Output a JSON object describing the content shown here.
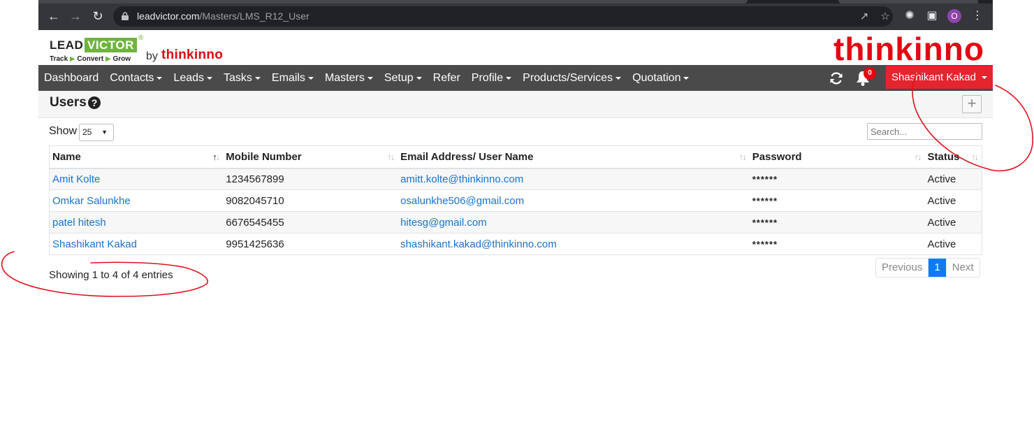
{
  "browser": {
    "url_host": "leadvictor.com",
    "url_path": "/Masters/LMS_R12_User",
    "profile_initial": "O"
  },
  "brand": {
    "logo_lead": "LEAD",
    "logo_victor": "VICTOR",
    "logo_reg": "®",
    "tagline": [
      "Track",
      "Convert",
      "Grow"
    ],
    "by": "by",
    "by_brand": "thinkinno",
    "right_brand": "thinkinno"
  },
  "nav": {
    "items": [
      {
        "label": "Dashboard",
        "dropdown": false
      },
      {
        "label": "Contacts",
        "dropdown": true
      },
      {
        "label": "Leads",
        "dropdown": true
      },
      {
        "label": "Tasks",
        "dropdown": true
      },
      {
        "label": "Emails",
        "dropdown": true
      },
      {
        "label": "Masters",
        "dropdown": true
      },
      {
        "label": "Setup",
        "dropdown": true
      },
      {
        "label": "Refer",
        "dropdown": false
      },
      {
        "label": "Profile",
        "dropdown": true
      },
      {
        "label": "Products/Services",
        "dropdown": true
      },
      {
        "label": "Quotation",
        "dropdown": true
      }
    ],
    "notification_count": "0",
    "user_name": "Shashikant Kakad"
  },
  "page": {
    "title": "Users",
    "add_label": "+"
  },
  "controls": {
    "show_label": "Show",
    "length_value": "25",
    "search_placeholder": "Search..."
  },
  "table": {
    "columns": [
      "Name",
      "Mobile Number",
      "Email Address/ User Name",
      "Password",
      "Status"
    ],
    "rows": [
      {
        "name": "Amit Kolte",
        "mobile": "1234567899",
        "email": "amitt.kolte@thinkinno.com",
        "password": "******",
        "status": "Active"
      },
      {
        "name": "Omkar Salunkhe",
        "mobile": "9082045710",
        "email": "osalunkhe506@gmail.com",
        "password": "******",
        "status": "Active"
      },
      {
        "name": "patel hitesh",
        "mobile": "6676545455",
        "email": "hitesg@gmail.com",
        "password": "******",
        "status": "Active"
      },
      {
        "name": "Shashikant Kakad",
        "mobile": "9951425636",
        "email": "shashikant.kakad@thinkinno.com",
        "password": "******",
        "status": "Active"
      }
    ]
  },
  "footer": {
    "info": "Showing 1 to 4 of 4 entries",
    "previous": "Previous",
    "current_page": "1",
    "next": "Next"
  },
  "colors": {
    "navbar": "#4a4a4a",
    "brand_red": "#e30613",
    "brand_green": "#6fb43f",
    "link": "#1a73c8",
    "page_active": "#0d7cf2",
    "annotation": "#e0121b"
  }
}
